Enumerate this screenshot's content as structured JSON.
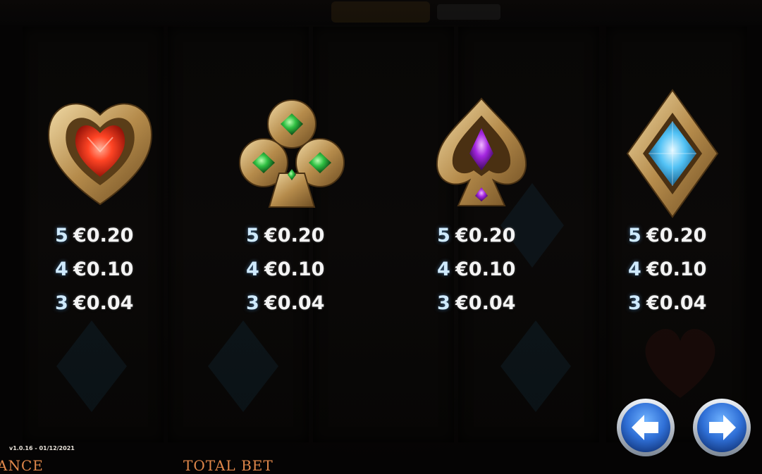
{
  "paytable": {
    "symbols": [
      {
        "name": "heart",
        "rows": [
          {
            "count": "5",
            "value": "€0.20"
          },
          {
            "count": "4",
            "value": "€0.10"
          },
          {
            "count": "3",
            "value": "€0.04"
          }
        ]
      },
      {
        "name": "club",
        "rows": [
          {
            "count": "5",
            "value": "€0.20"
          },
          {
            "count": "4",
            "value": "€0.10"
          },
          {
            "count": "3",
            "value": "€0.04"
          }
        ]
      },
      {
        "name": "spade",
        "rows": [
          {
            "count": "5",
            "value": "€0.20"
          },
          {
            "count": "4",
            "value": "€0.10"
          },
          {
            "count": "3",
            "value": "€0.04"
          }
        ]
      },
      {
        "name": "diamond",
        "rows": [
          {
            "count": "5",
            "value": "€0.20"
          },
          {
            "count": "4",
            "value": "€0.10"
          },
          {
            "count": "3",
            "value": "€0.04"
          }
        ]
      }
    ]
  },
  "navigation": {
    "prev_icon": "arrow-left-icon",
    "next_icon": "arrow-right-icon",
    "button_color": "#2f6fd6"
  },
  "footer": {
    "version": "v1.0.16 - 01/12/2021",
    "balance_label": "ANCE",
    "total_bet_label": "TOTAL BET"
  },
  "colors": {
    "heart_gem": "#e8331c",
    "club_gem": "#2fb84a",
    "spade_gem": "#9b2fd6",
    "diamond_gem": "#4ec3ff",
    "gold": "#c9a56a"
  }
}
